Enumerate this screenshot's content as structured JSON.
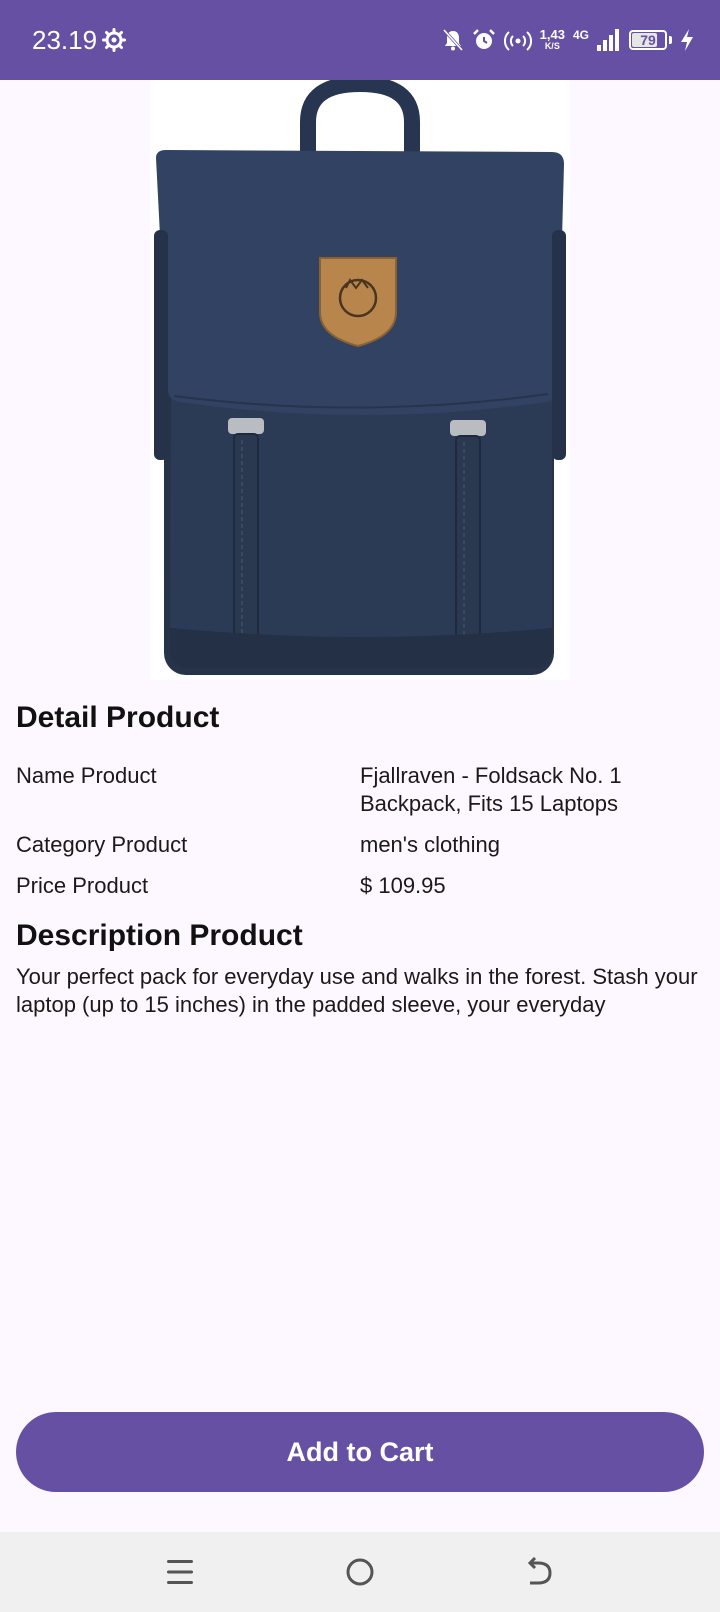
{
  "status_bar": {
    "time": "23.19",
    "net_speed": "1,43",
    "net_speed_unit": "K/S",
    "network_type": "4G",
    "battery_level": "79",
    "battery_fraction": 0.79,
    "background_color": "#6650a4"
  },
  "product": {
    "image_icon": "backpack-image",
    "detail_title": "Detail Product",
    "details": [
      {
        "label": "Name Product",
        "value": "Fjallraven - Foldsack No. 1 Backpack, Fits 15 Laptops"
      },
      {
        "label": "Category Product",
        "value": "men's clothing"
      },
      {
        "label": "Price Product",
        "value": "$ 109.95"
      }
    ],
    "description_title": "Description Product",
    "description": "Your perfect pack for everyday use and walks in the forest. Stash your laptop (up to 15 inches) in the padded sleeve, your everyday"
  },
  "actions": {
    "add_to_cart_label": "Add to Cart",
    "accent_color": "#6650a4"
  },
  "nav_bar": {
    "icons": [
      "menu-icon",
      "home-icon",
      "back-icon"
    ]
  }
}
